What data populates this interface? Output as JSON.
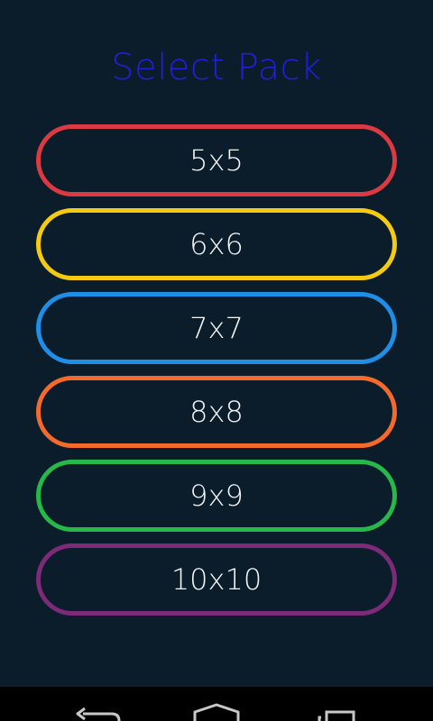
{
  "title": "Select Pack",
  "packs": [
    {
      "label": "5x5",
      "color": "#dc3a43"
    },
    {
      "label": "6x6",
      "color": "#f5cb12"
    },
    {
      "label": "7x7",
      "color": "#1f8ee6"
    },
    {
      "label": "8x8",
      "color": "#f46a2b"
    },
    {
      "label": "9x9",
      "color": "#27b84a"
    },
    {
      "label": "10x10",
      "color": "#7d2a78"
    }
  ],
  "navbar": {
    "icons": [
      "back-icon",
      "home-icon",
      "recent-apps-icon"
    ],
    "icon_color": "#c8c8c8"
  },
  "colors": {
    "background": "#0b1c2a",
    "title": "#2020d8",
    "button_text": "#f4f6f8"
  }
}
